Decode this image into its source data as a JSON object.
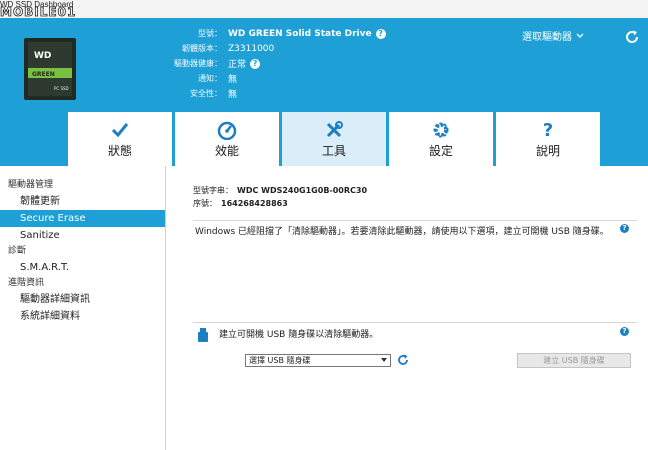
{
  "window": {
    "title": "WD SSD Dashboard",
    "watermark": "MOBILE01"
  },
  "header": {
    "fields": [
      {
        "label": "型號：",
        "value": "WD GREEN Solid State Drive",
        "bold": true,
        "help": true
      },
      {
        "label": "韌體版本：",
        "value": "Z3311000",
        "bold": false,
        "help": false
      },
      {
        "label": "驅動器健康：",
        "value": "正常",
        "bold": false,
        "help": true
      },
      {
        "label": "通知：",
        "value": "無",
        "bold": false,
        "help": false
      },
      {
        "label": "安全性：",
        "value": "無",
        "bold": false,
        "help": false
      }
    ],
    "drive_select_label": "選取驅動器",
    "drive_image_text": {
      "top": "WD",
      "mid": "GREEN",
      "tag": "PC SSD"
    }
  },
  "tabs": [
    {
      "label": "狀態",
      "icon": "checkmark-icon"
    },
    {
      "label": "效能",
      "icon": "gauge-icon"
    },
    {
      "label": "工具",
      "icon": "tools-icon",
      "active": true
    },
    {
      "label": "設定",
      "icon": "gear-icon"
    },
    {
      "label": "說明",
      "icon": "question-icon"
    }
  ],
  "sidebar": {
    "sections": [
      {
        "heading": "驅動器管理",
        "items": [
          "韌體更新",
          "Secure Erase",
          "Sanitize"
        ]
      },
      {
        "heading": "診斷",
        "items": [
          "S.M.A.R.T."
        ]
      },
      {
        "heading": "進階資訊",
        "items": [
          "驅動器詳細資訊",
          "系統詳細資料"
        ]
      }
    ],
    "active_item": "Secure Erase"
  },
  "main": {
    "model_label": "型號字串：",
    "model_value": "WDC WDS240G1G0B-00RC30",
    "serial_label": "序號：",
    "serial_value": "164268428863",
    "notice": "Windows 已經阻擋了「清除驅動器」。若要清除此驅動器，請使用以下選項，建立可開機 USB 隨身碟。",
    "usb_instruction": "建立可開機 USB 隨身碟以清除驅動器。",
    "usb_select_value": "選擇 USB 隨身碟",
    "create_button_label": "建立 USB 隨身碟"
  },
  "colors": {
    "accent": "#1e9fd6",
    "tab_active": "#d9eef8",
    "help_blue": "#1e7fc0"
  }
}
